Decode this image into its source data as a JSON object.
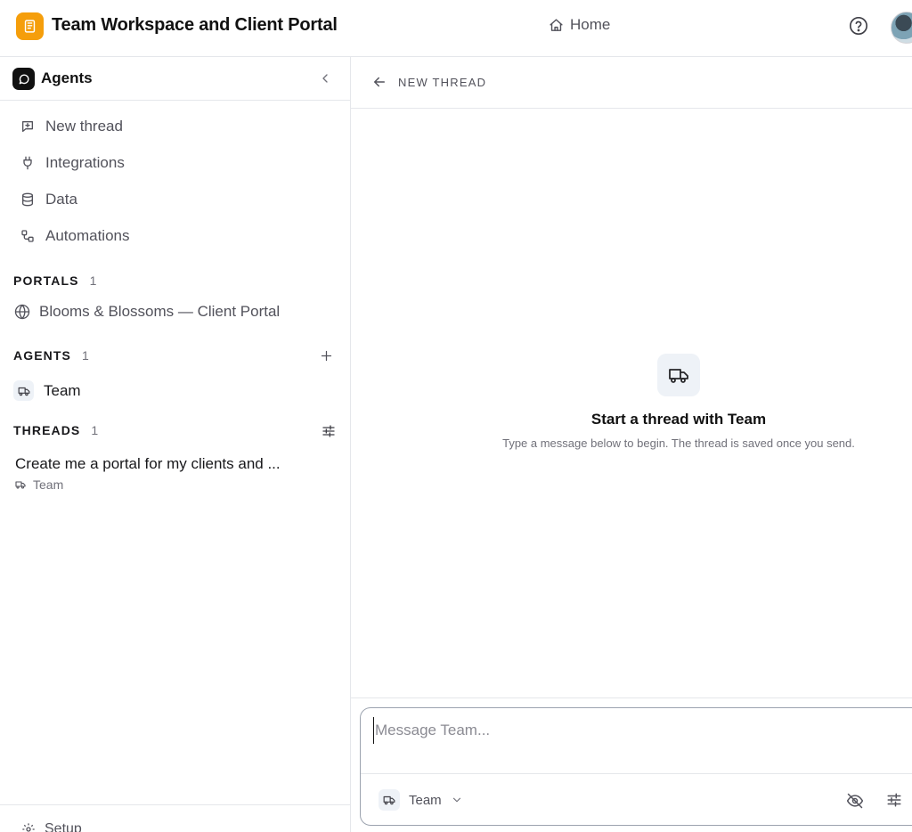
{
  "app": {
    "title": "Team Workspace and Client Portal",
    "home_label": "Home"
  },
  "sidebar": {
    "title": "Agents",
    "nav": [
      {
        "label": "New thread",
        "icon": "message-plus-icon"
      },
      {
        "label": "Integrations",
        "icon": "plug-icon"
      },
      {
        "label": "Data",
        "icon": "database-icon"
      },
      {
        "label": "Automations",
        "icon": "workflow-icon"
      }
    ],
    "portals": {
      "heading": "PORTALS",
      "count": "1",
      "items": [
        {
          "label": "Blooms & Blossoms — Client Portal",
          "icon": "globe-icon"
        }
      ]
    },
    "agents": {
      "heading": "AGENTS",
      "count": "1",
      "items": [
        {
          "label": "Team",
          "icon": "truck-icon"
        }
      ]
    },
    "threads": {
      "heading": "THREADS",
      "count": "1",
      "items": [
        {
          "title": "Create me a portal for my clients and ...",
          "agent": "Team"
        }
      ]
    },
    "footer": {
      "setup_label": "Setup"
    }
  },
  "main": {
    "header_label": "NEW THREAD",
    "empty_state": {
      "title": "Start a thread with Team",
      "subtitle": "Type a message below to begin. The thread is saved once you send."
    },
    "composer": {
      "placeholder": "Message Team...",
      "value": "",
      "agent_label": "Team"
    }
  },
  "colors": {
    "brand": "#f59e0b",
    "border": "#e5e7eb",
    "muted_text": "#71717a",
    "chip_bg": "#eef2f7"
  }
}
